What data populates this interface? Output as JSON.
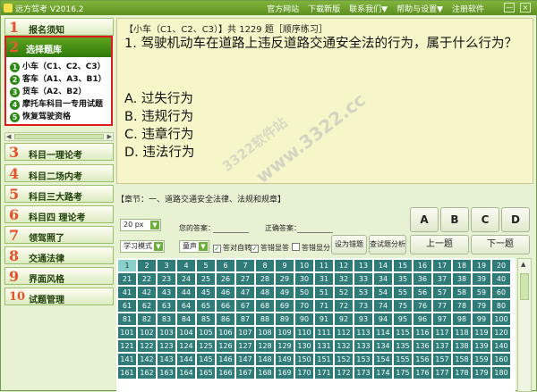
{
  "app": {
    "title": "远方驾考 V2016.2"
  },
  "titlebar": {
    "menu": [
      "官方网站",
      "下载新版",
      "联系我们▼",
      "帮助与设置▼",
      "注册软件"
    ],
    "minimize": "—",
    "close": "×"
  },
  "sidebar": {
    "items": [
      {
        "num": "1",
        "label": "报名须知"
      },
      {
        "num": "3",
        "label": "科目一理论考"
      },
      {
        "num": "4",
        "label": "科目二场内考"
      },
      {
        "num": "5",
        "label": "科目三大路考"
      },
      {
        "num": "6",
        "label": "科目四 理论考"
      },
      {
        "num": "7",
        "label": "领驾照了"
      },
      {
        "num": "8",
        "label": "交通法律"
      },
      {
        "num": "9",
        "label": "界面风格"
      },
      {
        "num": "10",
        "label": "试题管理"
      }
    ],
    "selected": {
      "num": "2",
      "label": "选择题库"
    },
    "subitems": [
      {
        "num": "1",
        "label": "小车（C1、C2、C3）"
      },
      {
        "num": "2",
        "label": "客车（A1、A3、B1）"
      },
      {
        "num": "3",
        "label": "货车（A2、B2）"
      },
      {
        "num": "4",
        "label": "摩托车科目一专用试题"
      },
      {
        "num": "5",
        "label": "恢复驾驶资格"
      }
    ]
  },
  "question": {
    "header": "【小车（C1、C2、C3）】共 1229 题［顺序练习］",
    "text": "1. 驾驶机动车在道路上违反道路交通安全法的行为，属于什么行为？",
    "options": [
      "A. 过失行为",
      "B. 违规行为",
      "C. 违章行为",
      "D. 违法行为"
    ]
  },
  "watermark": {
    "text1": "3322软件站",
    "text2": "www.3322.cc"
  },
  "chapter": "【章节：一、道路交通安全法律、法规和规章】",
  "controls": {
    "font_size": "20 px",
    "mode": "学习模式",
    "your_answer_label": "您的答案：",
    "correct_answer_label": "正确答案：",
    "sound": "童声",
    "auto_next": "答对自转",
    "show_wrong": "答错显答",
    "wrong_count": "答错显分",
    "set_wrong_btn": "设为错题",
    "analysis_btn": "查试题分析",
    "answer_buttons": [
      "A",
      "B",
      "C",
      "D"
    ],
    "prev_btn": "上一题",
    "next_btn": "下一题"
  },
  "grid": {
    "start": 1,
    "end": 180,
    "columns": 20,
    "current": 1
  },
  "colors": {
    "titlebar": "#6aa12a",
    "cell": "#2e7b78",
    "accent_red": "#e01a1a",
    "panel": "#f6f6c8"
  }
}
